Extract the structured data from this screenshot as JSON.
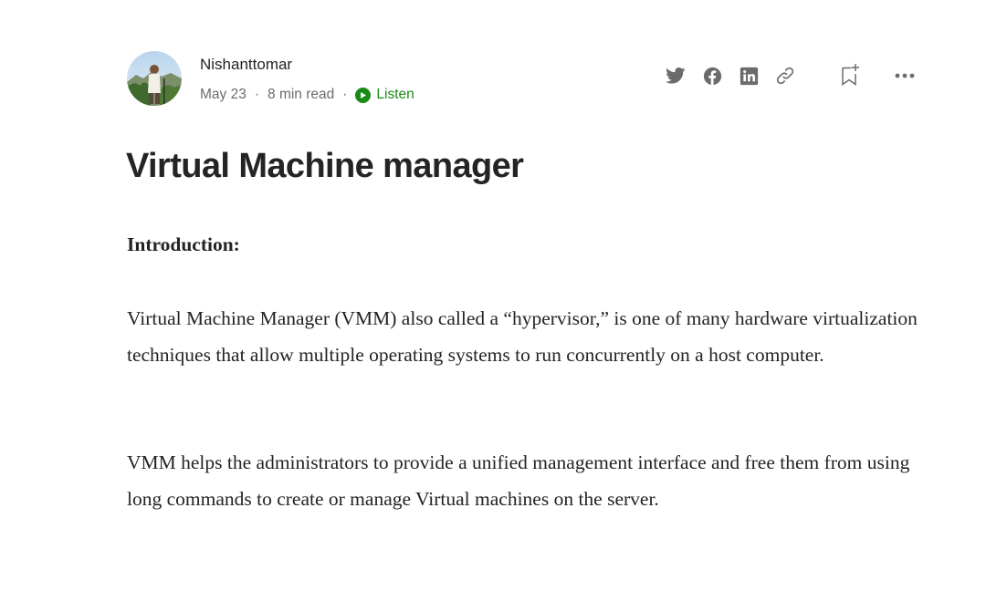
{
  "author": {
    "name": "Nishanttomar",
    "date": "May 23",
    "read_time": "8 min read",
    "separator": "·",
    "listen_label": "Listen"
  },
  "toolbar": {
    "icons": [
      "twitter-icon",
      "facebook-icon",
      "linkedin-icon",
      "link-icon",
      "bookmark-add-icon",
      "more-icon"
    ]
  },
  "article": {
    "title": "Virtual Machine manager",
    "section_heading": "Introduction:",
    "paragraphs": [
      "Virtual Machine Manager (VMM) also called a “hypervisor,” is one of many hardware virtualization techniques that allow multiple operating systems to run concurrently on a host computer.",
      "VMM helps the administrators to provide a unified management interface and free them from using long commands to create or manage Virtual machines on the server."
    ]
  },
  "colors": {
    "text": "#242424",
    "muted": "#6b6b6b",
    "accent_green": "#1a8917",
    "icon_gray": "#6b6b6b"
  }
}
